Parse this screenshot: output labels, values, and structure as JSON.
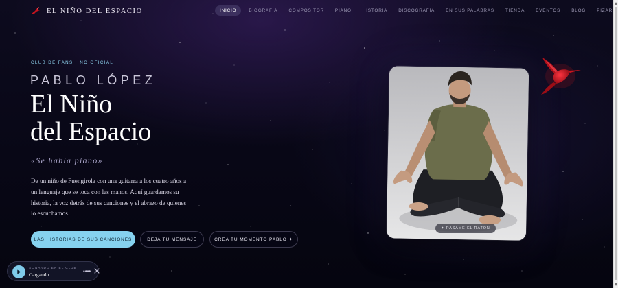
{
  "header": {
    "brand_name": "EL NIÑO DEL ESPACIO",
    "nav_items": [
      {
        "label": "INICIO",
        "active": true
      },
      {
        "label": "BIOGRAFÍA",
        "active": false
      },
      {
        "label": "COMPOSITOR",
        "active": false
      },
      {
        "label": "PIANO",
        "active": false
      },
      {
        "label": "HISTORIA",
        "active": false
      },
      {
        "label": "DISCOGRAFÍA",
        "active": false
      },
      {
        "label": "EN SUS PALABRAS",
        "active": false
      },
      {
        "label": "TIENDA",
        "active": false
      },
      {
        "label": "EVENTOS",
        "active": false
      },
      {
        "label": "BLOG",
        "active": false
      },
      {
        "label": "PIZARRA",
        "active": false
      }
    ]
  },
  "hero": {
    "eyebrow": "CLUB DE FANS · NO OFICIAL",
    "artist": "PABLO LÓPEZ",
    "title_line1": "El Niño",
    "title_line2": "del Espacio",
    "tagline": "«Se habla piano»",
    "description": "De un niño de Fuengirola con una guitarra a los cuatro años a un lenguaje que se toca con las manos. Aquí guardamos su historia, la voz detrás de sus canciones y el abrazo de quienes lo escuchamos.",
    "buttons": {
      "primary": "LAS HISTORIAS DE SUS CANCIONES",
      "message": "DEJA TU MENSAJE",
      "moment": "CREA TU MOMENTO PABLO ✦"
    },
    "hover_hint": "✦ PÁSAME EL RATÓN"
  },
  "player": {
    "label": "SONANDO EN EL CLUB",
    "status": "Cargando...",
    "more": "••••",
    "close_icon": "close-icon",
    "play_icon": "play-icon"
  },
  "colors": {
    "accent": "#86d2ef",
    "background": "#080716",
    "hummingbird": "#c8141e"
  }
}
